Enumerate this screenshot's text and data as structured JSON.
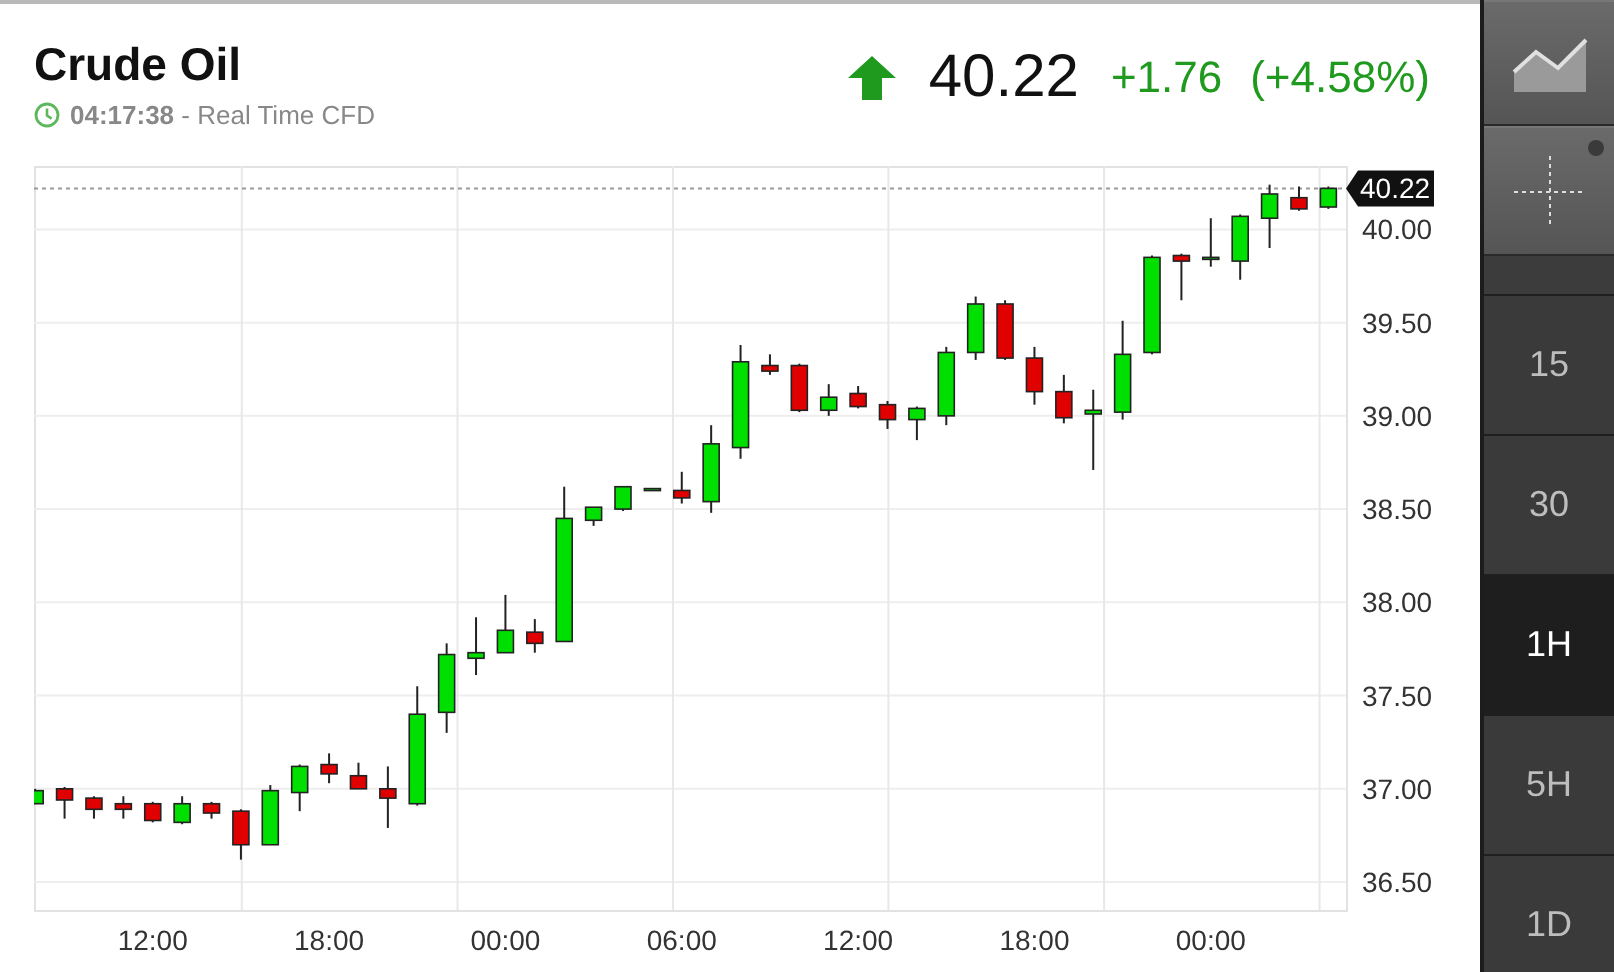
{
  "instrument": {
    "name": "Crude Oil",
    "time": "04:17:38",
    "feed": "- Real Time CFD"
  },
  "quote": {
    "up": true,
    "price": "40.22",
    "change": "+1.76",
    "change_percent": "(+4.58%)"
  },
  "chart": {
    "price_tag": "40.22",
    "chart_data": {
      "type": "candlestick",
      "categories": [
        null,
        null,
        null,
        null,
        "12:00",
        null,
        null,
        null,
        null,
        null,
        "18:00",
        null,
        null,
        null,
        null,
        null,
        "00:00",
        null,
        null,
        null,
        null,
        null,
        "06:00",
        null,
        null,
        null,
        null,
        null,
        "12:00",
        null,
        null,
        null,
        null,
        null,
        "18:00",
        null,
        null,
        null,
        null,
        null,
        "00:00",
        null,
        null,
        null,
        null
      ],
      "ylim": [
        36.35,
        40.34
      ],
      "grid": true,
      "ref_lines": [
        {
          "axis": "y",
          "value": 40.22
        }
      ],
      "yticks": [
        {
          "value": 36.5,
          "label": "36.50"
        },
        {
          "value": 37,
          "label": "37.00"
        },
        {
          "value": 37.5,
          "label": "37.50"
        },
        {
          "value": 38,
          "label": "38.00"
        },
        {
          "value": 38.5,
          "label": "38.50"
        },
        {
          "value": 39,
          "label": "39.00"
        },
        {
          "value": 39.5,
          "label": "39.50"
        },
        {
          "value": 40,
          "label": "40.00"
        }
      ],
      "ohlc": [
        [
          36.92,
          37.0,
          36.92,
          36.99
        ],
        [
          37.0,
          37.01,
          36.84,
          36.94
        ],
        [
          36.95,
          36.96,
          36.84,
          36.89
        ],
        [
          36.92,
          36.96,
          36.84,
          36.89
        ],
        [
          36.92,
          36.93,
          36.82,
          36.83
        ],
        [
          36.82,
          36.96,
          36.81,
          36.92
        ],
        [
          36.92,
          36.93,
          36.84,
          36.87
        ],
        [
          36.88,
          36.89,
          36.62,
          36.7
        ],
        [
          36.7,
          37.02,
          36.7,
          36.99
        ],
        [
          36.98,
          37.13,
          36.88,
          37.12
        ],
        [
          37.13,
          37.19,
          37.03,
          37.08
        ],
        [
          37.07,
          37.14,
          37.0,
          37.0
        ],
        [
          37.0,
          37.12,
          36.79,
          36.95
        ],
        [
          36.92,
          37.55,
          36.91,
          37.4
        ],
        [
          37.41,
          37.78,
          37.3,
          37.72
        ],
        [
          37.7,
          37.92,
          37.61,
          37.73
        ],
        [
          37.73,
          38.04,
          37.73,
          37.85
        ],
        [
          37.84,
          37.91,
          37.73,
          37.78
        ],
        [
          37.79,
          38.62,
          37.79,
          38.45
        ],
        [
          38.44,
          38.51,
          38.41,
          38.51
        ],
        [
          38.5,
          38.62,
          38.49,
          38.62
        ],
        [
          38.61,
          38.61,
          38.61,
          38.61
        ],
        [
          38.6,
          38.7,
          38.53,
          38.56
        ],
        [
          38.54,
          38.95,
          38.48,
          38.85
        ],
        [
          38.83,
          39.38,
          38.77,
          39.29
        ],
        [
          39.27,
          39.33,
          39.22,
          39.24
        ],
        [
          39.27,
          39.28,
          39.02,
          39.03
        ],
        [
          39.03,
          39.17,
          39.0,
          39.1
        ],
        [
          39.12,
          39.16,
          39.04,
          39.05
        ],
        [
          39.06,
          39.08,
          38.93,
          38.98
        ],
        [
          38.98,
          39.05,
          38.87,
          39.04
        ],
        [
          39.0,
          39.37,
          38.95,
          39.34
        ],
        [
          39.34,
          39.64,
          39.3,
          39.6
        ],
        [
          39.6,
          39.62,
          39.3,
          39.31
        ],
        [
          39.31,
          39.37,
          39.06,
          39.13
        ],
        [
          39.13,
          39.22,
          38.96,
          38.99
        ],
        [
          39.01,
          39.14,
          38.71,
          39.03
        ],
        [
          39.02,
          39.51,
          38.98,
          39.33
        ],
        [
          39.34,
          39.86,
          39.33,
          39.85
        ],
        [
          39.86,
          39.87,
          39.62,
          39.83
        ],
        [
          39.85,
          40.06,
          39.8,
          39.85
        ],
        [
          39.83,
          40.08,
          39.73,
          40.07
        ],
        [
          40.06,
          40.24,
          39.9,
          40.19
        ],
        [
          40.17,
          40.23,
          40.1,
          40.11
        ],
        [
          40.12,
          40.23,
          40.11,
          40.22
        ]
      ]
    }
  },
  "timeframes": [
    {
      "label": "15",
      "selected": false
    },
    {
      "label": "30",
      "selected": false
    },
    {
      "label": "1H",
      "selected": true
    },
    {
      "label": "5H",
      "selected": false
    },
    {
      "label": "1D",
      "selected": false
    }
  ]
}
